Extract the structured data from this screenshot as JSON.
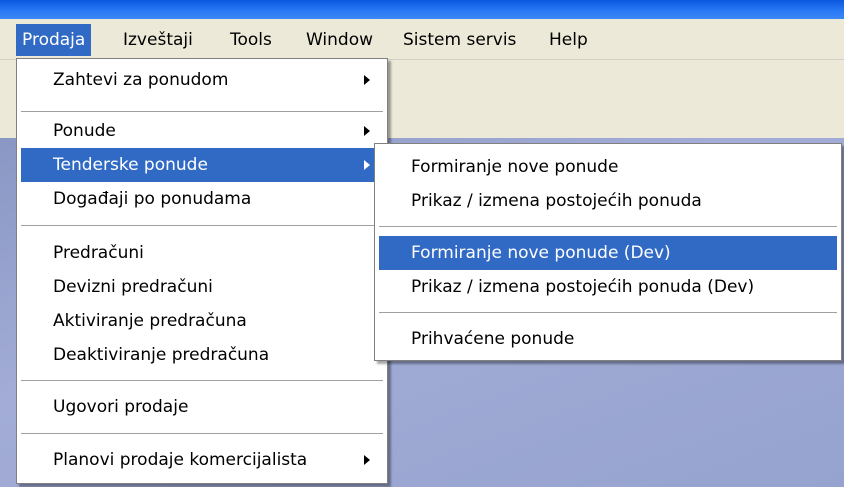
{
  "menubar": {
    "items": [
      {
        "label": "Prodaja"
      },
      {
        "label": "Izveštaji"
      },
      {
        "label": "Tools"
      },
      {
        "label": "Window"
      },
      {
        "label": "Sistem servis"
      },
      {
        "label": "Help"
      }
    ]
  },
  "prodaja_menu": {
    "items": [
      {
        "label": "Zahtevi za ponudom"
      },
      {
        "label": "Ponude"
      },
      {
        "label": "Tenderske ponude"
      },
      {
        "label": "Događaji po ponudama"
      },
      {
        "label": "Predračuni"
      },
      {
        "label": "Devizni predračuni"
      },
      {
        "label": "Aktiviranje predračuna"
      },
      {
        "label": "Deaktiviranje predračuna"
      },
      {
        "label": "Ugovori prodaje"
      },
      {
        "label": "Planovi prodaje komercijalista"
      }
    ]
  },
  "tenderske_submenu": {
    "items": [
      {
        "label": "Formiranje nove ponude"
      },
      {
        "label": "Prikaz / izmena postojećih ponuda"
      },
      {
        "label": "Formiranje nove ponude (Dev)"
      },
      {
        "label": "Prikaz / izmena postojećih ponuda (Dev)"
      },
      {
        "label": "Prihvaćene ponude"
      }
    ]
  },
  "colors": {
    "highlight": "#316ac5",
    "menu_bg": "#ffffff",
    "menubar_bg": "#ece9d8"
  }
}
